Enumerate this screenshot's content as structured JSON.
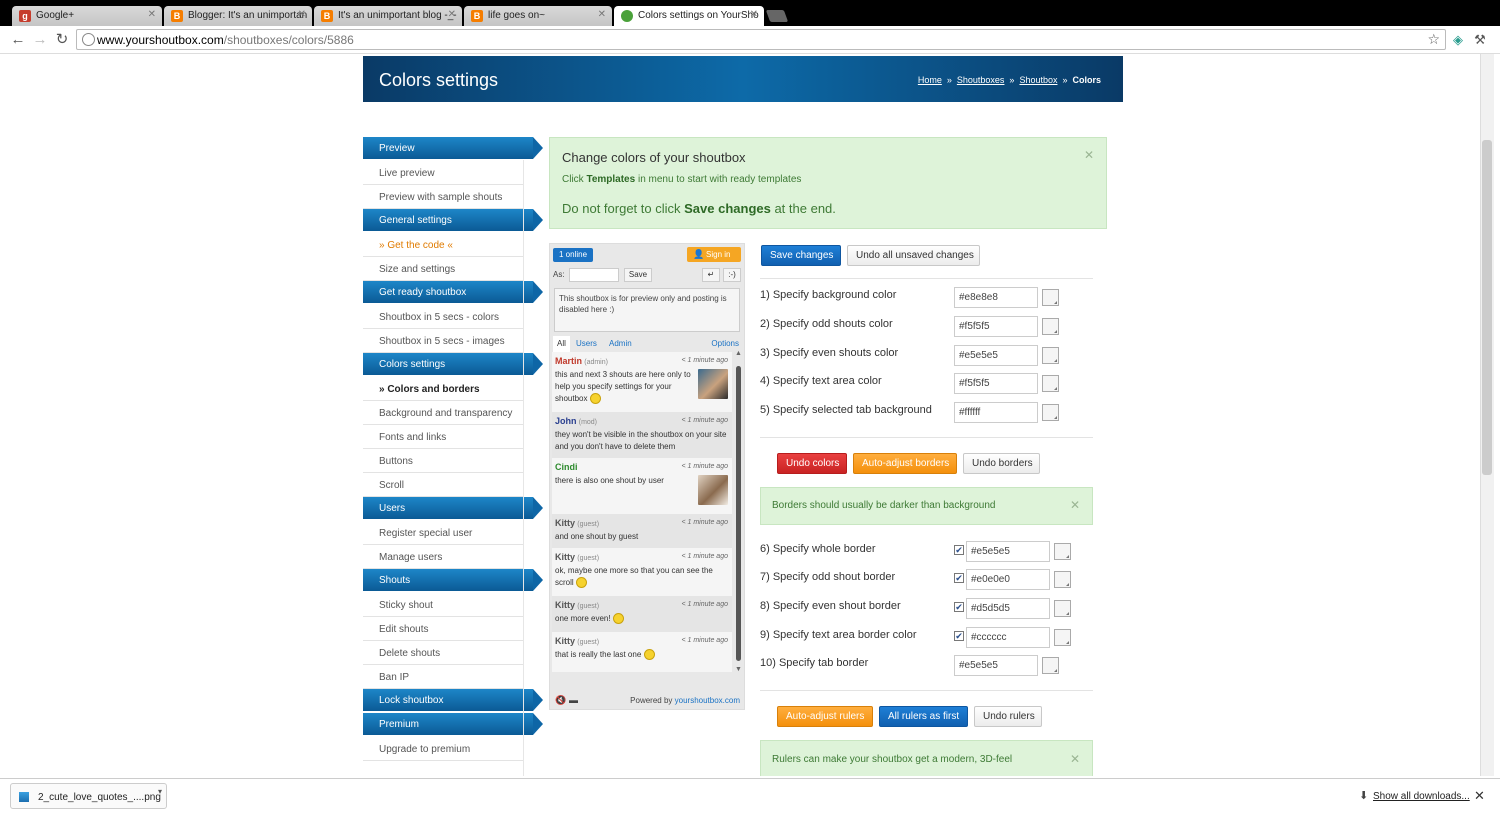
{
  "browser": {
    "tabs": [
      {
        "title": "Google+",
        "icon": "google-plus",
        "color": "#c63d2d"
      },
      {
        "title": "Blogger: It's an unimportan",
        "icon": "blogger",
        "color": "#f57d00"
      },
      {
        "title": "It's an unimportant blog -_-",
        "icon": "blogger",
        "color": "#f57d00"
      },
      {
        "title": "life goes on~",
        "icon": "blogger",
        "color": "#f57d00"
      },
      {
        "title": "Colors settings on YourSho",
        "icon": "yourshoutbox",
        "color": "#4aa13a"
      }
    ],
    "url_host": "www.yourshoutbox.com",
    "url_path": "/shoutboxes/colors/5886"
  },
  "header": {
    "title": "Colors settings",
    "breadcrumb": [
      "Home",
      "Shoutboxes",
      "Shoutbox",
      "Colors"
    ],
    "sep": "»"
  },
  "menu": [
    {
      "type": "head",
      "label": "Preview"
    },
    {
      "type": "item",
      "label": "Live preview"
    },
    {
      "type": "item",
      "label": "Preview with sample shouts"
    },
    {
      "type": "head",
      "label": "General settings"
    },
    {
      "type": "item",
      "label": "» Get the code «",
      "style": "orange"
    },
    {
      "type": "item",
      "label": "Size and settings"
    },
    {
      "type": "head",
      "label": "Get ready shoutbox"
    },
    {
      "type": "item",
      "label": "Shoutbox in 5 secs - colors"
    },
    {
      "type": "item",
      "label": "Shoutbox in 5 secs - images"
    },
    {
      "type": "head",
      "label": "Colors settings"
    },
    {
      "type": "item",
      "label": "» Colors and borders",
      "style": "bold"
    },
    {
      "type": "item",
      "label": "Background and transparency"
    },
    {
      "type": "item",
      "label": "Fonts and links"
    },
    {
      "type": "item",
      "label": "Buttons"
    },
    {
      "type": "item",
      "label": "Scroll"
    },
    {
      "type": "head",
      "label": "Users"
    },
    {
      "type": "item",
      "label": "Register special user"
    },
    {
      "type": "item",
      "label": "Manage users"
    },
    {
      "type": "head",
      "label": "Shouts"
    },
    {
      "type": "item",
      "label": "Sticky shout"
    },
    {
      "type": "item",
      "label": "Edit shouts"
    },
    {
      "type": "item",
      "label": "Delete shouts"
    },
    {
      "type": "item",
      "label": "Ban IP"
    },
    {
      "type": "head",
      "label": "Lock shoutbox"
    },
    {
      "type": "head",
      "label": "Premium"
    },
    {
      "type": "item",
      "label": "Upgrade to premium"
    }
  ],
  "notice_main": {
    "title": "Change colors of your shoutbox",
    "line1_pre": "Click ",
    "line1_bold": "Templates",
    "line1_post": " in menu to start with ready templates",
    "line2_pre": "Do not forget to click ",
    "line2_bold": "Save changes",
    "line2_post": " at the end."
  },
  "shoutbox": {
    "online": "1 online",
    "signin": "Sign in",
    "as_label": "As:",
    "save": "Save",
    "enter": "↵",
    "smiley": ":-)",
    "textarea": "This shoutbox is for preview only and posting is disabled here :)",
    "tabs": [
      "All",
      "Users",
      "Admin",
      "Options"
    ],
    "shouts": [
      {
        "name": "Martin",
        "role": "(admin)",
        "time": "< 1 minute ago",
        "text": "this and next 3 shouts are here only to help you specify settings for your shoutbox",
        "name_color": "#c0392b"
      },
      {
        "name": "John",
        "role": "(mod)",
        "time": "< 1 minute ago",
        "text": "they won't be visible in the shoutbox on your site and you don't have to delete them",
        "name_color": "#2a3f8f"
      },
      {
        "name": "Cindi",
        "role": "",
        "time": "< 1 minute ago",
        "text": "there is also one shout by user",
        "name_color": "#2e8b2e"
      },
      {
        "name": "Kitty",
        "role": "(guest)",
        "time": "< 1 minute ago",
        "text": "and one shout by guest",
        "name_color": "#555555"
      },
      {
        "name": "Kitty",
        "role": "(guest)",
        "time": "< 1 minute ago",
        "text": "ok, maybe one more so that you can see the scroll",
        "name_color": "#555555"
      },
      {
        "name": "Kitty",
        "role": "(guest)",
        "time": "< 1 minute ago",
        "text": "one more even!",
        "name_color": "#555555"
      },
      {
        "name": "Kitty",
        "role": "(guest)",
        "time": "< 1 minute ago",
        "text": "that is really the last one",
        "name_color": "#555555"
      }
    ],
    "powered_pre": "Powered by ",
    "powered_link": "yourshoutbox.com"
  },
  "actions": {
    "save_changes": "Save changes",
    "undo_all": "Undo all unsaved changes",
    "undo_colors": "Undo colors",
    "auto_borders": "Auto-adjust borders",
    "undo_borders": "Undo borders",
    "auto_rulers": "Auto-adjust rulers",
    "rulers_first": "All rulers as first",
    "undo_rulers": "Undo rulers"
  },
  "colors": [
    {
      "label": "1) Specify background color",
      "value": "#e8e8e8"
    },
    {
      "label": "2) Specify odd shouts color",
      "value": "#f5f5f5"
    },
    {
      "label": "3) Specify even shouts color",
      "value": "#e5e5e5"
    },
    {
      "label": "4) Specify text area color",
      "value": "#f5f5f5"
    },
    {
      "label": "5) Specify selected tab background",
      "value": "#ffffff"
    }
  ],
  "borders": [
    {
      "label": "6) Specify whole border",
      "value": "#e5e5e5",
      "checked": true
    },
    {
      "label": "7) Specify odd shout border",
      "value": "#e0e0e0",
      "checked": true
    },
    {
      "label": "8) Specify even shout border",
      "value": "#d5d5d5",
      "checked": true
    },
    {
      "label": "9) Specify text area border color",
      "value": "#cccccc",
      "checked": true
    },
    {
      "label": "10) Specify tab border",
      "value": "#e5e5e5",
      "checked": false
    }
  ],
  "notice_borders": "Borders should usually be darker than background",
  "notice_rulers": "Rulers can make your shoutbox get a modern, 3D-feel",
  "downloads": {
    "file": "2_cute_love_quotes_....png",
    "show_all": "Show all downloads..."
  }
}
